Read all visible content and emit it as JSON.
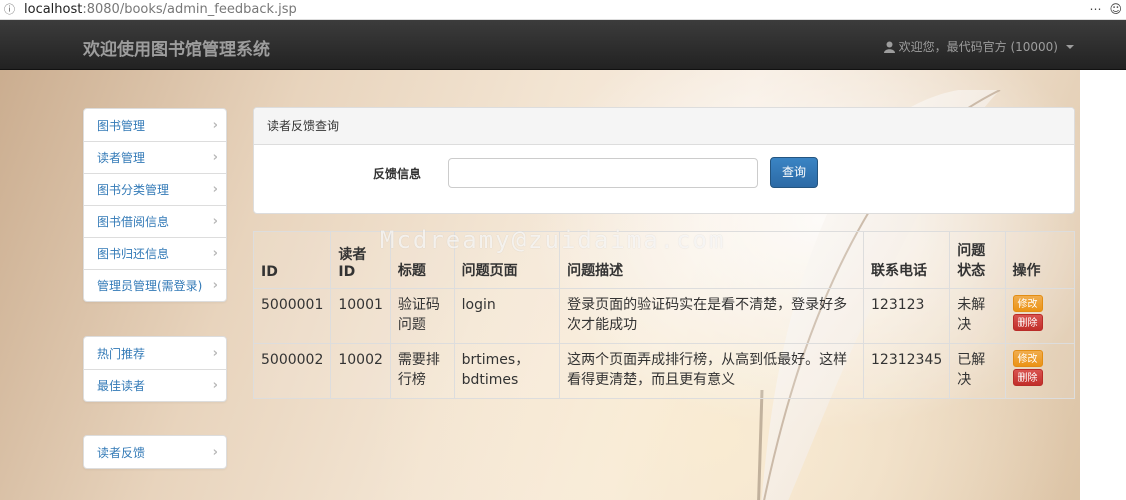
{
  "browser": {
    "url_host": "localhost",
    "url_path": ":8080/books/admin_feedback.jsp"
  },
  "navbar": {
    "brand": "欢迎使用图书馆管理系统",
    "user_text": "欢迎您，最代码官方 (10000)"
  },
  "sidebar": {
    "group1": [
      {
        "label": "图书管理"
      },
      {
        "label": "读者管理"
      },
      {
        "label": "图书分类管理"
      },
      {
        "label": "图书借阅信息"
      },
      {
        "label": "图书归还信息"
      },
      {
        "label": "管理员管理(需登录)"
      }
    ],
    "group2": [
      {
        "label": "热门推荐"
      },
      {
        "label": "最佳读者"
      }
    ],
    "group3": [
      {
        "label": "读者反馈"
      }
    ]
  },
  "query_panel": {
    "heading": "读者反馈查询",
    "field_label": "反馈信息",
    "input_value": "",
    "button_label": "查询"
  },
  "watermark": "Mcdreamy@zuidaima.com",
  "table": {
    "headers": [
      "ID",
      "读者ID",
      "标题",
      "问题页面",
      "问题描述",
      "联系电话",
      "问题状态",
      "操作"
    ],
    "rows": [
      {
        "id": "5000001",
        "reader_id": "10001",
        "title": "验证码问题",
        "page": "login",
        "description": "登录页面的验证码实在是看不清楚，登录好多次才能成功",
        "phone": "123123",
        "status": "未解决",
        "edit_label": "修改",
        "delete_label": "删除"
      },
      {
        "id": "5000002",
        "reader_id": "10002",
        "title": "需要排行榜",
        "page": "brtimes，bdtimes",
        "description": "这两个页面弄成排行榜，从高到低最好。这样看得更清楚，而且更有意义",
        "phone": "12312345",
        "status": "已解决",
        "edit_label": "修改",
        "delete_label": "删除"
      }
    ]
  }
}
